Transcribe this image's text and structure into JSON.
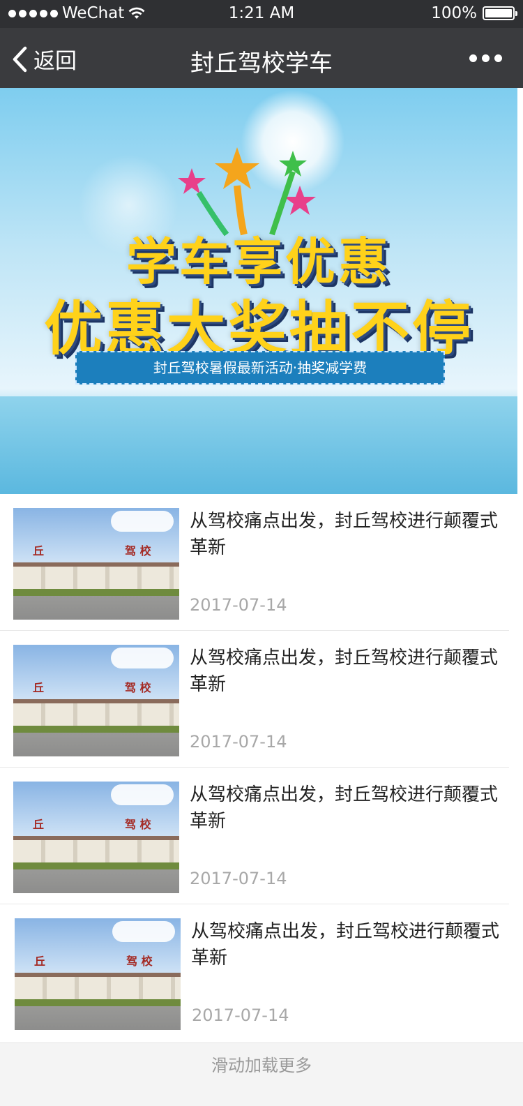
{
  "status_bar": {
    "carrier": "WeChat",
    "time": "1:21 AM",
    "battery": "100%"
  },
  "nav": {
    "back_label": "返回",
    "title": "封丘驾校学车"
  },
  "banner": {
    "headline_line1": "学车享优惠",
    "headline_line2": "优惠大奖抽不停",
    "ribbon": "封丘驾校暑假最新活动·抽奖减学费"
  },
  "articles": [
    {
      "title": "从驾校痛点出发，封丘驾校进行颠覆式革新",
      "date": "2017-07-14",
      "thumb_sign_left": "丘",
      "thumb_sign_right": "驾 校"
    },
    {
      "title": "从驾校痛点出发，封丘驾校进行颠覆式革新",
      "date": "2017-07-14",
      "thumb_sign_left": "丘",
      "thumb_sign_right": "驾 校"
    },
    {
      "title": "从驾校痛点出发，封丘驾校进行颠覆式革新",
      "date": "2017-07-14",
      "thumb_sign_left": "丘",
      "thumb_sign_right": "驾 校"
    },
    {
      "title": "从驾校痛点出发，封丘驾校进行颠覆式革新",
      "date": "2017-07-14",
      "thumb_sign_left": "丘",
      "thumb_sign_right": "驾 校"
    }
  ],
  "footer": {
    "load_more": "滑动加载更多"
  },
  "colors": {
    "nav_bg": "#3a3b3e",
    "status_bg": "#2f3033",
    "date_text": "#a8a8a8",
    "ribbon": "#1c7fbd"
  }
}
